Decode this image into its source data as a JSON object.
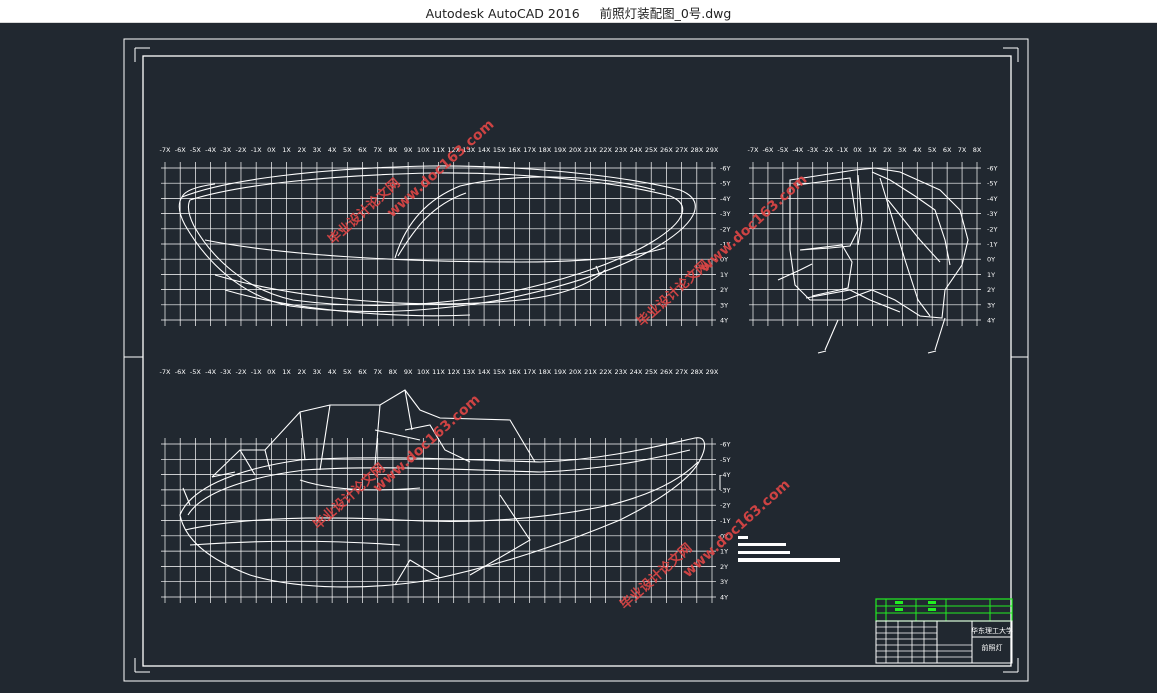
{
  "window": {
    "title": "Autodesk AutoCAD 2016     前照灯装配图_0号.dwg"
  },
  "colors": {
    "background": "#212830",
    "lines": "#ffffff",
    "title_block_accent": "#22ee22",
    "watermark": "#e04646"
  },
  "grids": {
    "side_view": {
      "x_labels": [
        "-7X",
        "-6X",
        "-5X",
        "-4X",
        "-3X",
        "-2X",
        "-1X",
        "0X",
        "1X",
        "2X",
        "3X",
        "4X",
        "5X",
        "6X",
        "7X",
        "8X",
        "9X",
        "10X",
        "11X",
        "12X",
        "13X",
        "14X",
        "15X",
        "16X",
        "17X",
        "18X",
        "19X",
        "20X",
        "21X",
        "22X",
        "23X",
        "24X",
        "25X",
        "26X",
        "27X",
        "28X",
        "29X"
      ],
      "y_labels": [
        "-6Y",
        "-5Y",
        "-4Y",
        "-3Y",
        "-2Y",
        "-1Y",
        "0Y",
        "1Y",
        "2Y",
        "3Y",
        "4Y"
      ]
    },
    "front_view": {
      "x_labels": [
        "-7X",
        "-6X",
        "-5X",
        "-4X",
        "-3X",
        "-2X",
        "-1X",
        "0X",
        "1X",
        "2X",
        "3X",
        "4X",
        "5X",
        "6X",
        "7X",
        "8X"
      ],
      "y_labels": [
        "-6Y",
        "-5Y",
        "-4Y",
        "-3Y",
        "-2Y",
        "-1Y",
        "0Y",
        "1Y",
        "2Y",
        "3Y",
        "4Y"
      ]
    },
    "top_view": {
      "x_labels": [
        "-7X",
        "-6X",
        "-5X",
        "-4X",
        "-3X",
        "-2X",
        "-1X",
        "0X",
        "1X",
        "2X",
        "3X",
        "4X",
        "5X",
        "6X",
        "7X",
        "8X",
        "9X",
        "10X",
        "11X",
        "12X",
        "13X",
        "14X",
        "15X",
        "16X",
        "17X",
        "18X",
        "19X",
        "20X",
        "21X",
        "22X",
        "23X",
        "24X",
        "25X",
        "26X",
        "27X",
        "28X",
        "29X"
      ],
      "y_labels": [
        "-6Y",
        "-5Y",
        "-4Y",
        "-3Y",
        "-2Y",
        "-1Y",
        "0Y",
        "1Y",
        "2Y",
        "3Y",
        "4Y"
      ]
    }
  },
  "watermarks": [
    {
      "url": "www.doc163.com",
      "label": "毕业设计论文网"
    },
    {
      "url": "www.doc163.com",
      "label": "毕业设计论文网"
    },
    {
      "url": "www.doc163.com",
      "label": "毕业设计论文网"
    },
    {
      "url": "www.doc163.com",
      "label": "毕业设计论文网"
    }
  ],
  "title_block": {
    "school": "华东理工大学",
    "part_name": "前照灯"
  }
}
